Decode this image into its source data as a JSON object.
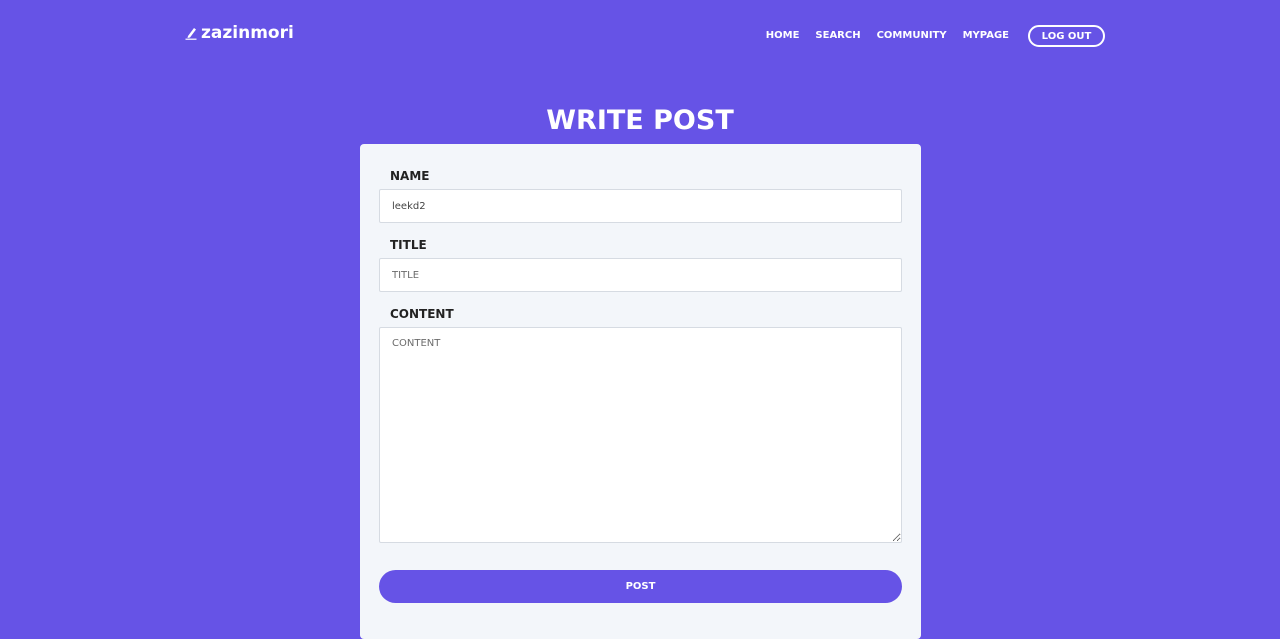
{
  "nav": {
    "brand": "zazinmori",
    "brand_icon": "pencil-icon",
    "links": [
      "HOME",
      "SEARCH",
      "COMMUNITY",
      "MYPAGE"
    ],
    "logout_label": "LOG OUT"
  },
  "page": {
    "title": "WRITE POST"
  },
  "form": {
    "name_label": "NAME",
    "name_value": "leekd2",
    "title_label": "TITLE",
    "title_placeholder": "TITLE",
    "content_label": "CONTENT",
    "content_placeholder": "CONTENT",
    "submit_label": "POST"
  },
  "colors": {
    "background": "#6653e6",
    "card": "#f3f6fa",
    "accent": "#6653e6",
    "text": "#222222"
  }
}
